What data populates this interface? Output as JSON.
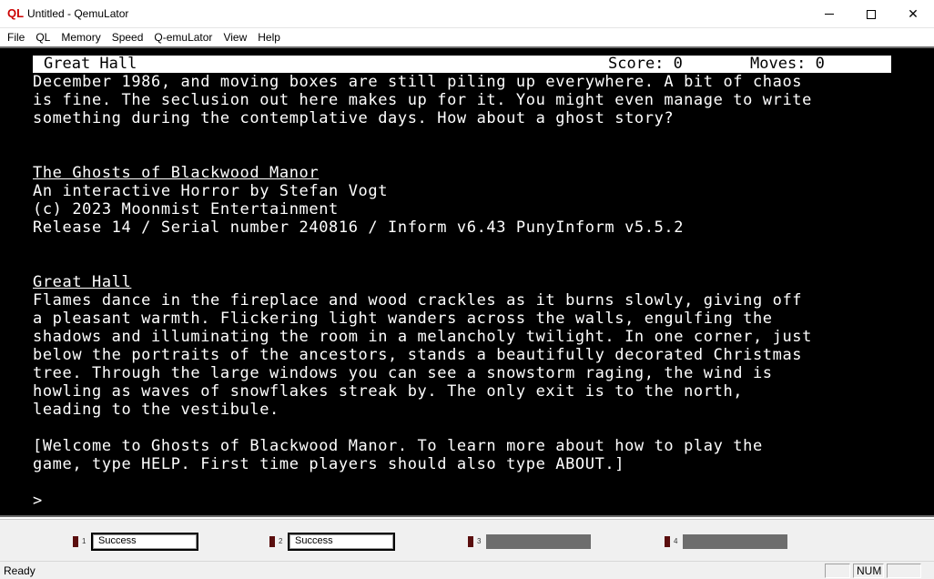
{
  "window": {
    "title": "Untitled - QemuLator",
    "icon": "QL",
    "minimize_glyph": "",
    "close_glyph": "✕"
  },
  "menu": [
    "File",
    "QL",
    "Memory",
    "Speed",
    "Q-emuLator",
    "View",
    "Help"
  ],
  "game": {
    "status": {
      "room": "Great Hall",
      "score": "Score: 0",
      "moves": "Moves: 0"
    },
    "lines": [
      "December 1986, and moving boxes are still piling up everywhere. A bit of chaos",
      "is fine. The seclusion out here makes up for it. You might even manage to write",
      "something during the contemplative days. How about a ghost story?",
      "",
      "",
      "The Ghosts of Blackwood Manor",
      "An interactive Horror by Stefan Vogt",
      "(c) 2023 Moonmist Entertainment",
      "Release 14 / Serial number 240816 / Inform v6.43 PunyInform v5.5.2",
      "",
      "",
      "Great Hall",
      "Flames dance in the fireplace and wood crackles as it burns slowly, giving off",
      "a pleasant warmth. Flickering light wanders across the walls, engulfing the",
      "shadows and illuminating the room in a melancholy twilight. In one corner, just",
      "below the portraits of the ancestors, stands a beautifully decorated Christmas",
      "tree. Through the large windows you can see a snowstorm raging, the wind is",
      "howling as waves of snowflakes streak by. The only exit is to the north,",
      "leading to the vestibule.",
      "",
      "[Welcome to Ghosts of Blackwood Manor. To learn more about how to play the",
      "game, type HELP. First time players should also type ABOUT.]",
      "",
      ">"
    ]
  },
  "drives": [
    {
      "number": "1",
      "label": "Success"
    },
    {
      "number": "2",
      "label": "Success"
    },
    {
      "number": "3",
      "label": ""
    },
    {
      "number": "4",
      "label": ""
    }
  ],
  "statusbar": {
    "text": "Ready",
    "cells": [
      "",
      "NUM",
      ""
    ]
  }
}
